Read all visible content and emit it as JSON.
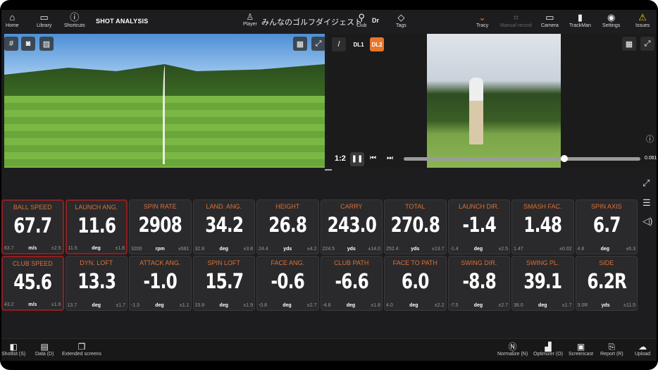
{
  "topbar": {
    "home": "Home",
    "library": "Library",
    "shortcuts": "Shortcuts",
    "title": "SHOT ANALYSIS",
    "player_label": "Player",
    "player_name": "みんなのゴルフダイジェスト",
    "club_label": "Club",
    "club_value": "Dr",
    "tags": "Tags",
    "tracy": "Tracy",
    "manual_record": "Manual record",
    "camera": "Camera",
    "trackman": "TrackMan",
    "settings": "Settings",
    "issues": "Issues"
  },
  "video": {
    "dl1": "DL1",
    "dl2": "DL2",
    "speed": "1:2",
    "time": "0.061",
    "progress": 0.68
  },
  "colors": {
    "accent": "#e8762b",
    "label": "#d9733a",
    "selected_border": "#8e1f1f",
    "background": "#1d1d1f"
  },
  "tiles": [
    {
      "label": "BALL SPEED",
      "value": "67.7",
      "prev": "63.7",
      "unit": "m/s",
      "dev": "±2.5",
      "selected": true
    },
    {
      "label": "LAUNCH ANG.",
      "value": "11.6",
      "prev": "11.5",
      "unit": "deg",
      "dev": "±1.8",
      "selected": true
    },
    {
      "label": "SPIN RATE",
      "value": "2908",
      "prev": "3200",
      "unit": "rpm",
      "dev": "±581"
    },
    {
      "label": "LAND. ANG.",
      "value": "34.2",
      "prev": "32.8",
      "unit": "deg",
      "dev": "±3.8"
    },
    {
      "label": "HEIGHT",
      "value": "26.8",
      "prev": "24.4",
      "unit": "yds",
      "dev": "±4.2"
    },
    {
      "label": "CARRY",
      "value": "243.0",
      "prev": "224.5",
      "unit": "yds",
      "dev": "±14.0"
    },
    {
      "label": "TOTAL",
      "value": "270.8",
      "prev": "252.4",
      "unit": "yds",
      "dev": "±13.7"
    },
    {
      "label": "LAUNCH DIR.",
      "value": "-1.4",
      "prev": "-1.4",
      "unit": "deg",
      "dev": "±2.5"
    },
    {
      "label": "SMASH FAC.",
      "value": "1.48",
      "prev": "1.47",
      "unit": "",
      "dev": "±0.02"
    },
    {
      "label": "SPIN AXIS",
      "value": "6.7",
      "prev": "4.8",
      "unit": "deg",
      "dev": "±6.3"
    },
    {
      "label": "CLUB SPEED",
      "value": "45.6",
      "prev": "43.2",
      "unit": "m/s",
      "dev": "±1.6",
      "selected": true
    },
    {
      "label": "DYN. LOFT",
      "value": "13.3",
      "prev": "13.7",
      "unit": "deg",
      "dev": "±1.7"
    },
    {
      "label": "ATTACK ANG.",
      "value": "-1.0",
      "prev": "-1.3",
      "unit": "deg",
      "dev": "±1.1"
    },
    {
      "label": "SPIN LOFT",
      "value": "15.7",
      "prev": "15.8",
      "unit": "deg",
      "dev": "±1.9"
    },
    {
      "label": "FACE ANG.",
      "value": "-0.6",
      "prev": "-0.8",
      "unit": "deg",
      "dev": "±2.7"
    },
    {
      "label": "CLUB PATH",
      "value": "-6.6",
      "prev": "-4.8",
      "unit": "deg",
      "dev": "±1.8"
    },
    {
      "label": "FACE TO PATH",
      "value": "6.0",
      "prev": "4.0",
      "unit": "deg",
      "dev": "±2.2"
    },
    {
      "label": "SWING DIR.",
      "value": "-8.8",
      "prev": "-7.5",
      "unit": "deg",
      "dev": "±2.7"
    },
    {
      "label": "SWING PL.",
      "value": "39.1",
      "prev": "38.0",
      "unit": "deg",
      "dev": "±1.7"
    },
    {
      "label": "SIDE",
      "value": "6.2R",
      "prev": "3.0R",
      "unit": "yds",
      "dev": "±11.5"
    }
  ],
  "bottombar": {
    "shotlist": "Shotlist (S)",
    "data": "Data (D)",
    "extended": "Extended screens",
    "normalize": "Normalize (N)",
    "optimizer": "Optimizer (O)",
    "screencast": "Screencast",
    "report": "Report (R)",
    "upload": "Upload"
  }
}
